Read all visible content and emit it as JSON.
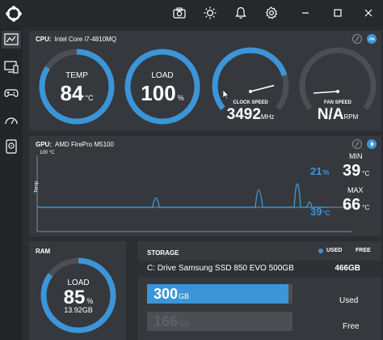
{
  "colors": {
    "accent": "#3b95d8",
    "panel": "#35383c",
    "background": "#2b2d30",
    "track": "#4b4f54"
  },
  "titlebar": {
    "icons": [
      "camera-icon",
      "brightness-icon",
      "bell-icon",
      "gear-icon"
    ],
    "window_controls": [
      "minimize-icon",
      "maximize-icon",
      "close-icon"
    ]
  },
  "sidebar": {
    "items": [
      "dashboard-icon",
      "monitor-icon",
      "gamepad-icon",
      "speedometer-icon",
      "storage-icon"
    ]
  },
  "cpu": {
    "title": "CPU:",
    "name": "Intel Core i7-4810MQ",
    "temp": {
      "label": "TEMP",
      "value": "84",
      "unit": "°C",
      "fraction": 0.84
    },
    "load": {
      "label": "LOAD",
      "value": "100",
      "unit": "%",
      "fraction": 1.0
    },
    "clock": {
      "label": "CLOCK SPEED",
      "value": "3492",
      "unit": "MHz",
      "fraction": 0.78
    },
    "fan": {
      "label": "FAN SPEED",
      "value": "N/A",
      "unit": "RPM",
      "fraction": 0.0
    }
  },
  "gpu": {
    "title": "GPU:",
    "name": "AMD FirePro M5100",
    "y_top_label": "100 °C",
    "y_axis_label": "Temp",
    "load_pct": "21",
    "load_unit": "%",
    "temp_now": "39",
    "temp_unit": "°C",
    "min_label": "MIN",
    "min_value": "39",
    "min_unit": "°C",
    "max_label": "MAX",
    "max_value": "66",
    "max_unit": "°C"
  },
  "ram": {
    "title": "RAM",
    "load_label": "LOAD",
    "load_value": "85",
    "load_unit": "%",
    "used": "13.92GB",
    "fraction": 0.85
  },
  "storage": {
    "title": "STORAGE",
    "legend_used": "USED",
    "legend_free": "FREE",
    "drive_name": "C: Drive Samsung SSD 850 EVO 500GB",
    "drive_size": "466GB",
    "used_value": "300",
    "used_unit": "GB",
    "used_label": "Used",
    "free_value": "166",
    "free_unit": "GB",
    "free_label": "Free",
    "used_fraction": 0.64
  }
}
